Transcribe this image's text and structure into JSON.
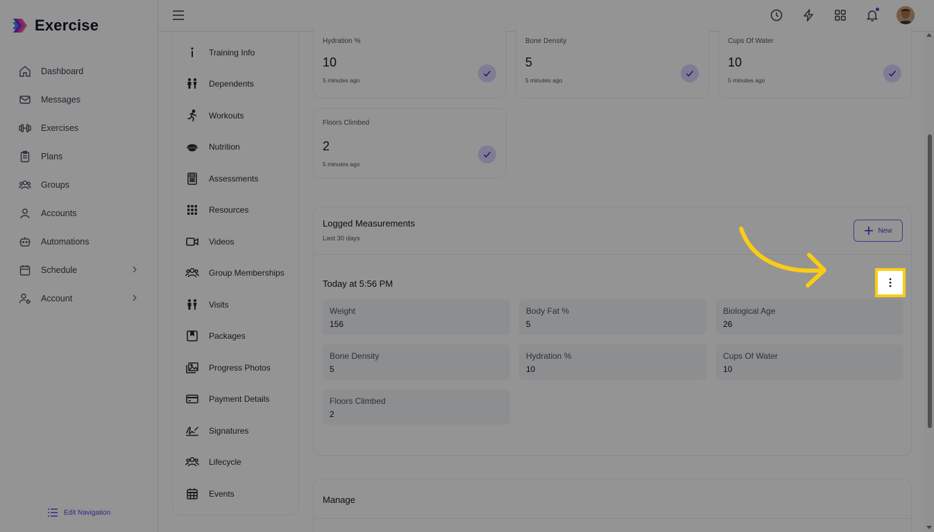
{
  "brand": {
    "name": "Exercise"
  },
  "sidebar": {
    "items": [
      {
        "label": "Dashboard",
        "icon": "home-icon"
      },
      {
        "label": "Messages",
        "icon": "mail-icon"
      },
      {
        "label": "Exercises",
        "icon": "dumbbell-icon"
      },
      {
        "label": "Plans",
        "icon": "clipboard-icon"
      },
      {
        "label": "Groups",
        "icon": "users-icon"
      },
      {
        "label": "Accounts",
        "icon": "user-icon"
      },
      {
        "label": "Automations",
        "icon": "robot-icon"
      },
      {
        "label": "Schedule",
        "icon": "calendar-icon",
        "has_chevron": true
      },
      {
        "label": "Account",
        "icon": "user-gear-icon",
        "has_chevron": true
      }
    ],
    "edit_navigation": "Edit Navigation"
  },
  "topbar": {
    "icons": [
      "history-icon",
      "bolt-icon",
      "apps-grid-icon",
      "bell-icon",
      "avatar"
    ],
    "notification_dot_color": "#4f46e5"
  },
  "subnav": {
    "items": [
      {
        "label": "Training Info",
        "icon": "info-icon"
      },
      {
        "label": "Dependents",
        "icon": "family-icon"
      },
      {
        "label": "Workouts",
        "icon": "running-icon"
      },
      {
        "label": "Nutrition",
        "icon": "bowl-icon"
      },
      {
        "label": "Assessments",
        "icon": "calculator-icon"
      },
      {
        "label": "Resources",
        "icon": "grid-dots-icon"
      },
      {
        "label": "Videos",
        "icon": "video-icon"
      },
      {
        "label": "Group Memberships",
        "icon": "users-icon"
      },
      {
        "label": "Visits",
        "icon": "family-icon"
      },
      {
        "label": "Packages",
        "icon": "package-icon"
      },
      {
        "label": "Progress Photos",
        "icon": "photos-icon"
      },
      {
        "label": "Payment Details",
        "icon": "credit-card-icon"
      },
      {
        "label": "Signatures",
        "icon": "signature-icon"
      },
      {
        "label": "Lifecycle",
        "icon": "users-icon"
      },
      {
        "label": "Events",
        "icon": "calendar-grid-icon"
      }
    ]
  },
  "metric_cards": [
    {
      "label": "Hydration %",
      "value": "10",
      "ago": "5 minutes ago"
    },
    {
      "label": "Bone Density",
      "value": "5",
      "ago": "5 minutes ago"
    },
    {
      "label": "Cups Of Water",
      "value": "10",
      "ago": "5 minutes ago"
    },
    {
      "label": "Floors Climbed",
      "value": "2",
      "ago": "5 minutes ago"
    }
  ],
  "logged": {
    "title": "Logged Measurements",
    "subtitle": "Last 30 days",
    "new_label": "New",
    "entry_title": "Today at 5:56 PM",
    "cells": [
      {
        "label": "Weight",
        "value": "156"
      },
      {
        "label": "Body Fat %",
        "value": "5"
      },
      {
        "label": "Biological Age",
        "value": "26"
      },
      {
        "label": "Bone Density",
        "value": "5"
      },
      {
        "label": "Hydration %",
        "value": "10"
      },
      {
        "label": "Cups Of Water",
        "value": "10"
      },
      {
        "label": "Floors Climbed",
        "value": "2"
      }
    ]
  },
  "manage": {
    "title": "Manage"
  },
  "colors": {
    "accent": "#4f46e5",
    "highlight": "#facc15",
    "check_bg": "#ddd6fe"
  }
}
